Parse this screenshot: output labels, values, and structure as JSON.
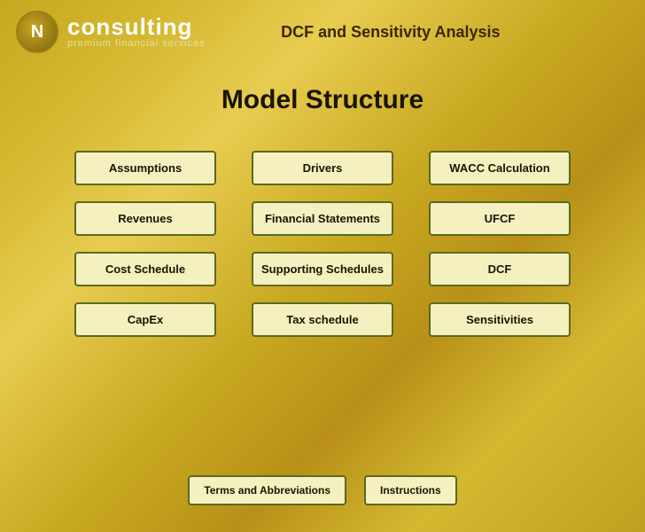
{
  "logo": {
    "letter": "N",
    "name": "consulting",
    "tagline": "premium financial services"
  },
  "header": {
    "title": "DCF and Sensitivity Analysis"
  },
  "main": {
    "title": "Model Structure"
  },
  "columns": [
    {
      "id": "col1",
      "buttons": [
        {
          "id": "assumptions",
          "label": "Assumptions"
        },
        {
          "id": "revenues",
          "label": "Revenues"
        },
        {
          "id": "cost-schedule",
          "label": "Cost Schedule"
        },
        {
          "id": "capex",
          "label": "CapEx"
        }
      ]
    },
    {
      "id": "col2",
      "buttons": [
        {
          "id": "drivers",
          "label": "Drivers"
        },
        {
          "id": "financial-statements",
          "label": "Financial Statements"
        },
        {
          "id": "supporting-schedules",
          "label": "Supporting Schedules"
        },
        {
          "id": "tax-schedule",
          "label": "Tax schedule"
        }
      ]
    },
    {
      "id": "col3",
      "buttons": [
        {
          "id": "wacc-calculation",
          "label": "WACC Calculation"
        },
        {
          "id": "ufcf",
          "label": "UFCF"
        },
        {
          "id": "dcf",
          "label": "DCF"
        },
        {
          "id": "sensitivities",
          "label": "Sensitivities"
        }
      ]
    }
  ],
  "footer": {
    "buttons": [
      {
        "id": "terms-and-abbreviations",
        "label": "Terms and Abbreviations"
      },
      {
        "id": "instructions",
        "label": "Instructions"
      }
    ]
  }
}
